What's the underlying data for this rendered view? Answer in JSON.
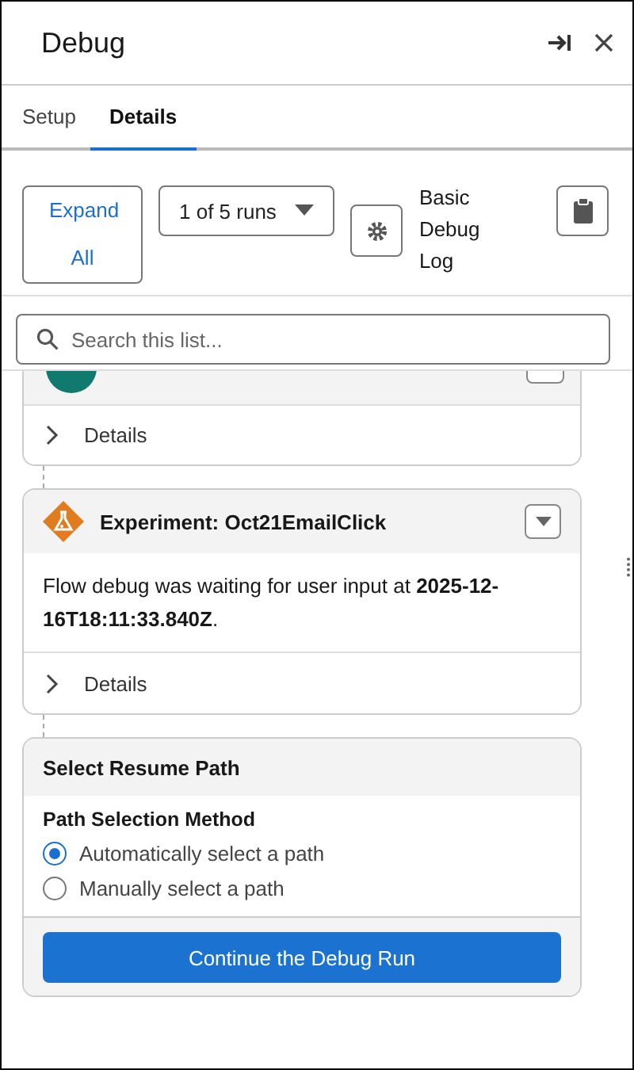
{
  "panel": {
    "title": "Debug"
  },
  "tabs": [
    {
      "label": "Setup",
      "selected": false
    },
    {
      "label": "Details",
      "selected": true
    }
  ],
  "toolbar": {
    "expand_button": "Expand All",
    "runs_select": "1 of 5 runs",
    "log_label": "Basic Debug Log"
  },
  "search": {
    "placeholder": "Search this list..."
  },
  "cards": [
    {
      "kind": "partial",
      "details_label": "Details",
      "expanded": false
    },
    {
      "kind": "experiment",
      "title": "Experiment: Oct21EmailClick",
      "message": "Flow debug was waiting for user input at **2025-12-16T18:11:33.840Z**.",
      "details_label": "Details",
      "expanded": false
    }
  ],
  "resume": {
    "title": "Select Resume Path",
    "group_label": "Path Selection Method",
    "options": [
      {
        "label": "Automatically select a path",
        "selected": true
      },
      {
        "label": "Manually select a path",
        "selected": false
      }
    ],
    "button": "Continue the Debug Run"
  }
}
